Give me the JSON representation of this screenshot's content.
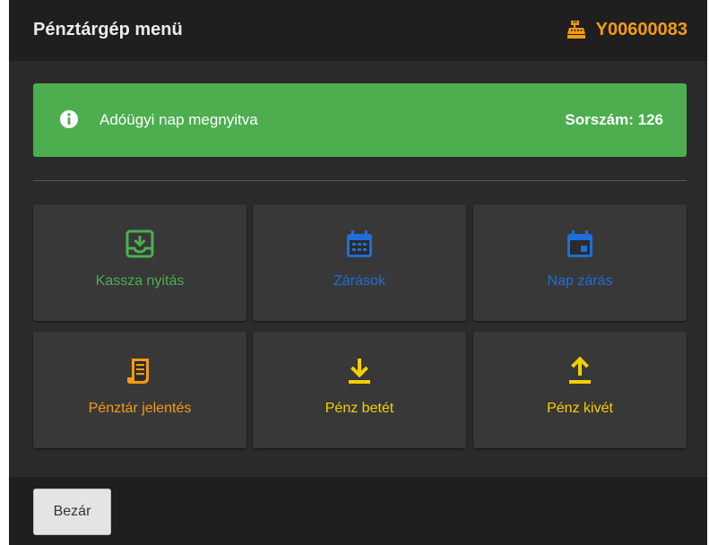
{
  "header": {
    "title": "Pénztárgép menü",
    "device_id": "Y00600083",
    "device_icon": "cash-register-icon"
  },
  "alert": {
    "icon": "info-circle-icon",
    "message": "Adóügyi nap megnyitva",
    "serial": "Sorszám: 126",
    "color": "#4cae4f"
  },
  "tiles": [
    {
      "label": "Kassza nyitás",
      "icon": "inbox-in-icon",
      "color": "#4caf50"
    },
    {
      "label": "Zárások",
      "icon": "calendar-grid-icon",
      "color": "#1e6fd9"
    },
    {
      "label": "Nap zárás",
      "icon": "calendar-day-icon",
      "color": "#1e6fd9"
    },
    {
      "label": "Pénztár jelentés",
      "icon": "receipt-icon",
      "color": "#f39c12"
    },
    {
      "label": "Pénz betét",
      "icon": "download-icon",
      "color": "#f5d000"
    },
    {
      "label": "Pénz kivét",
      "icon": "upload-icon",
      "color": "#f5d000"
    }
  ],
  "footer": {
    "close_label": "Bezár"
  },
  "colors": {
    "accent_orange": "#f39c12",
    "blue": "#1e6fd9",
    "green": "#4caf50",
    "yellow": "#f5d000"
  }
}
